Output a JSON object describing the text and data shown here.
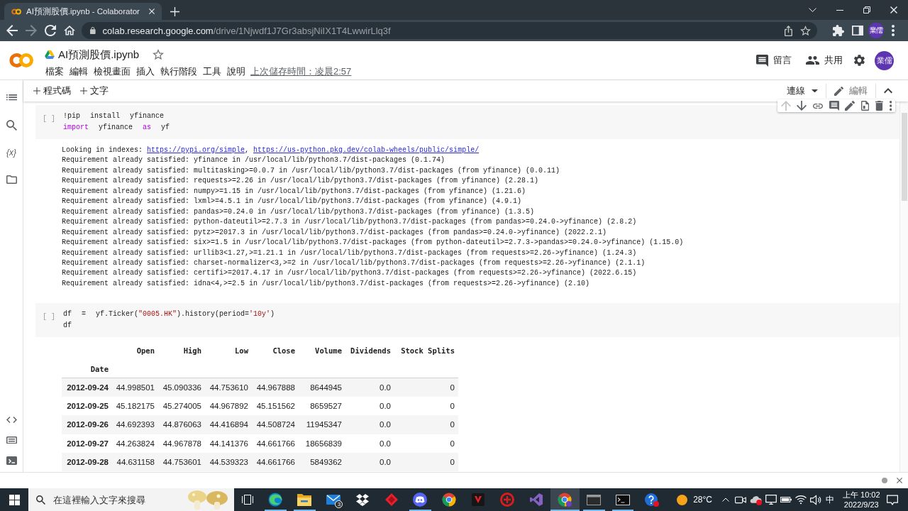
{
  "browser": {
    "tab": {
      "title": "AI預測股價.ipynb - Colaborator"
    },
    "nav": [
      {
        "kind": "back",
        "disabled": false
      },
      {
        "kind": "forward",
        "disabled": true
      },
      {
        "kind": "reload",
        "disabled": false
      },
      {
        "kind": "home",
        "disabled": false
      }
    ],
    "address": {
      "host": "colab.research.google.com",
      "path": "/drive/1Njwdf1J7Gr3absjNiIX1T4LwwirLlq3f"
    },
    "profile": "業儒"
  },
  "notebook": {
    "title": "AI預測股價.ipynb",
    "starred": false,
    "menu": [
      "檔案",
      "編輯",
      "檢視畫面",
      "插入",
      "執行階段",
      "工具",
      "說明"
    ],
    "last_saved": "上次儲存時間：凌晨2:57",
    "actions": [
      {
        "kind": "comment",
        "label": "留言"
      },
      {
        "kind": "share",
        "label": "共用"
      }
    ],
    "avatar": "業儒"
  },
  "toolbar": {
    "insert": [
      "程式碼",
      "文字"
    ],
    "runtime": "連線",
    "mode": "編輯"
  },
  "sidebar": {
    "top": [
      {
        "kind": "toc"
      },
      {
        "kind": "search"
      },
      {
        "kind": "variables",
        "label": "{x}"
      },
      {
        "kind": "files"
      }
    ],
    "bottom": [
      {
        "kind": "snippets"
      },
      {
        "kind": "palette"
      },
      {
        "kind": "terminal"
      }
    ]
  },
  "cells": [
    {
      "kind": "code",
      "prompt": "[ ]",
      "toolbar": [
        {
          "kind": "up",
          "disabled": true
        },
        {
          "kind": "down",
          "disabled": false
        },
        {
          "kind": "link",
          "disabled": false
        },
        {
          "kind": "comment",
          "disabled": false
        },
        {
          "kind": "edit",
          "disabled": false
        },
        {
          "kind": "mirror",
          "disabled": false
        },
        {
          "kind": "delete",
          "disabled": false
        },
        {
          "kind": "more",
          "disabled": false
        }
      ],
      "source": [
        [
          {
            "kind": "plain",
            "text": "!pip install yfinance"
          }
        ],
        [
          {
            "kind": "keyword",
            "text": "import"
          },
          {
            "kind": "plain",
            "text": " yfinance "
          },
          {
            "kind": "keyword",
            "text": "as"
          },
          {
            "kind": "plain",
            "text": " yf"
          }
        ]
      ],
      "output": {
        "kind": "stream",
        "lines": [
          [
            {
              "kind": "text",
              "text": "Looking in indexes: "
            },
            {
              "kind": "link",
              "text": "https://pypi.org/simple"
            },
            {
              "kind": "text",
              "text": ", "
            },
            {
              "kind": "link",
              "text": "https://us-python.pkg.dev/colab-wheels/public/simple/"
            }
          ],
          [
            {
              "kind": "text",
              "text": "Requirement already satisfied: yfinance in /usr/local/lib/python3.7/dist-packages (0.1.74)"
            }
          ],
          [
            {
              "kind": "text",
              "text": "Requirement already satisfied: multitasking>=0.0.7 in /usr/local/lib/python3.7/dist-packages (from yfinance) (0.0.11)"
            }
          ],
          [
            {
              "kind": "text",
              "text": "Requirement already satisfied: requests>=2.26 in /usr/local/lib/python3.7/dist-packages (from yfinance) (2.28.1)"
            }
          ],
          [
            {
              "kind": "text",
              "text": "Requirement already satisfied: numpy>=1.15 in /usr/local/lib/python3.7/dist-packages (from yfinance) (1.21.6)"
            }
          ],
          [
            {
              "kind": "text",
              "text": "Requirement already satisfied: lxml>=4.5.1 in /usr/local/lib/python3.7/dist-packages (from yfinance) (4.9.1)"
            }
          ],
          [
            {
              "kind": "text",
              "text": "Requirement already satisfied: pandas>=0.24.0 in /usr/local/lib/python3.7/dist-packages (from yfinance) (1.3.5)"
            }
          ],
          [
            {
              "kind": "text",
              "text": "Requirement already satisfied: python-dateutil>=2.7.3 in /usr/local/lib/python3.7/dist-packages (from pandas>=0.24.0->yfinance) (2.8.2)"
            }
          ],
          [
            {
              "kind": "text",
              "text": "Requirement already satisfied: pytz>=2017.3 in /usr/local/lib/python3.7/dist-packages (from pandas>=0.24.0->yfinance) (2022.2.1)"
            }
          ],
          [
            {
              "kind": "text",
              "text": "Requirement already satisfied: six>=1.5 in /usr/local/lib/python3.7/dist-packages (from python-dateutil>=2.7.3->pandas>=0.24.0->yfinance) (1.15.0)"
            }
          ],
          [
            {
              "kind": "text",
              "text": "Requirement already satisfied: urllib3<1.27,>=1.21.1 in /usr/local/lib/python3.7/dist-packages (from requests>=2.26->yfinance) (1.24.3)"
            }
          ],
          [
            {
              "kind": "text",
              "text": "Requirement already satisfied: charset-normalizer<3,>=2 in /usr/local/lib/python3.7/dist-packages (from requests>=2.26->yfinance) (2.1.1)"
            }
          ],
          [
            {
              "kind": "text",
              "text": "Requirement already satisfied: certifi>=2017.4.17 in /usr/local/lib/python3.7/dist-packages (from requests>=2.26->yfinance) (2022.6.15)"
            }
          ],
          [
            {
              "kind": "text",
              "text": "Requirement already satisfied: idna<4,>=2.5 in /usr/local/lib/python3.7/dist-packages (from requests>=2.26->yfinance) (2.10)"
            }
          ]
        ]
      }
    },
    {
      "kind": "code",
      "prompt": "[ ]",
      "source": [
        [
          {
            "kind": "plain",
            "text": "df = yf.Ticker("
          },
          {
            "kind": "string",
            "text": "\"0005.HK\""
          },
          {
            "kind": "plain",
            "text": ").history(period="
          },
          {
            "kind": "string",
            "text": "'10y'"
          },
          {
            "kind": "plain",
            "text": ")"
          }
        ],
        [
          {
            "kind": "plain",
            "text": "df"
          }
        ]
      ],
      "output": {
        "kind": "table",
        "index_name": "Date",
        "columns": [
          "Open",
          "High",
          "Low",
          "Close",
          "Volume",
          "Dividends",
          "Stock Splits"
        ],
        "rows": [
          {
            "index": "2012-09-24",
            "values": [
              "44.998501",
              "45.090336",
              "44.753610",
              "44.967888",
              "8644945",
              "0.0",
              "0"
            ]
          },
          {
            "index": "2012-09-25",
            "values": [
              "45.182175",
              "45.274005",
              "44.967892",
              "45.151562",
              "8659527",
              "0.0",
              "0"
            ]
          },
          {
            "index": "2012-09-26",
            "values": [
              "44.692393",
              "44.876063",
              "44.416894",
              "44.508724",
              "11945347",
              "0.0",
              "0"
            ]
          },
          {
            "index": "2012-09-27",
            "values": [
              "44.263824",
              "44.967878",
              "44.141376",
              "44.661766",
              "18656839",
              "0.0",
              "0"
            ]
          },
          {
            "index": "2012-09-28",
            "values": [
              "44.631158",
              "44.753601",
              "44.539323",
              "44.661766",
              "5849362",
              "0.0",
              "0"
            ]
          }
        ]
      }
    }
  ],
  "taskbar": {
    "search": {
      "placeholder": "在這裡輸入文字來搜尋"
    },
    "apps": [
      {
        "kind": "edge",
        "selected": false,
        "running": true
      },
      {
        "kind": "explorer",
        "selected": false,
        "running": true
      },
      {
        "kind": "mail",
        "badge": "3",
        "selected": false,
        "running": false
      },
      {
        "kind": "dropbox",
        "selected": false,
        "running": false
      },
      {
        "kind": "diamond",
        "selected": false,
        "running": false
      },
      {
        "kind": "discord",
        "selected": false,
        "running": true
      },
      {
        "kind": "chrome",
        "selected": false,
        "running": false
      },
      {
        "kind": "vlogo",
        "selected": false,
        "running": false
      },
      {
        "kind": "ring",
        "selected": false,
        "running": false
      },
      {
        "kind": "vs",
        "selected": false,
        "running": false
      },
      {
        "kind": "chromeprofile",
        "selected": true,
        "running": true
      },
      {
        "kind": "console",
        "selected": false,
        "running": true
      },
      {
        "kind": "terminal",
        "selected": false,
        "running": true
      },
      {
        "kind": "help",
        "selected": false,
        "running": false
      }
    ],
    "weather": "28°C",
    "ime": "中",
    "time": "上午 10:02",
    "date": "2022/9/23"
  }
}
